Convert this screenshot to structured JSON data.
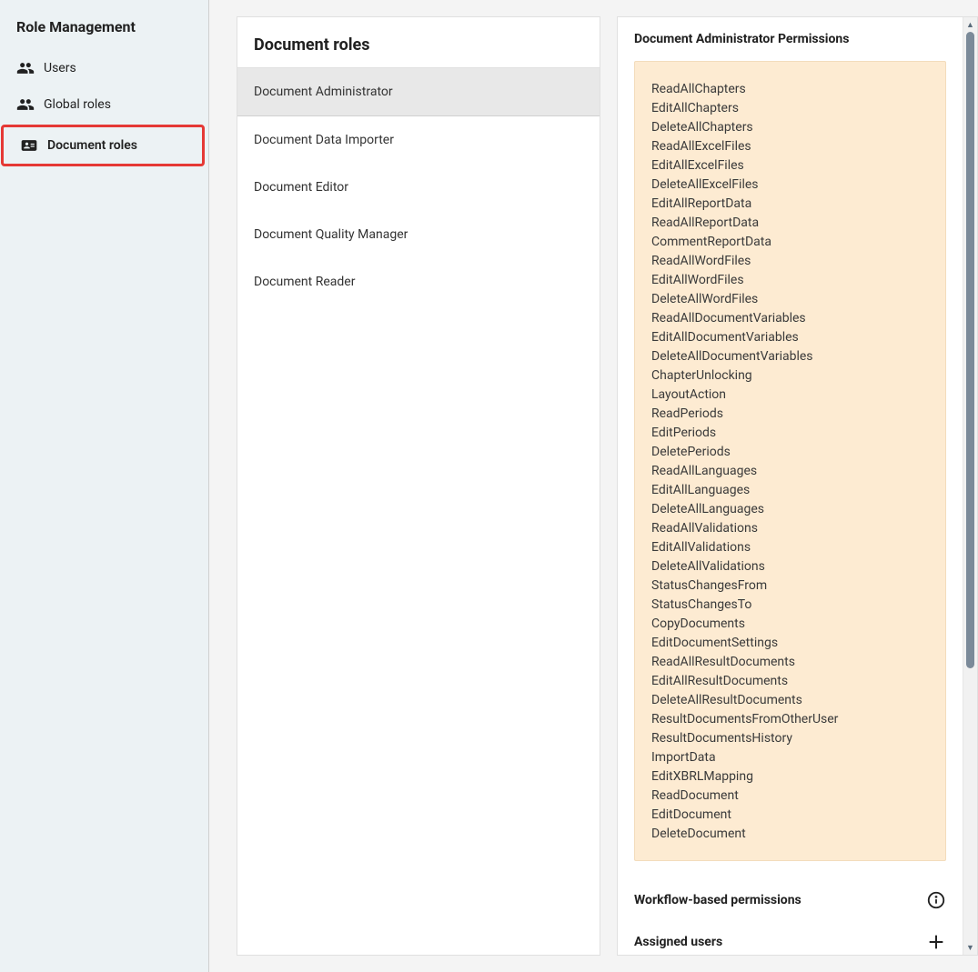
{
  "sidebar": {
    "title": "Role Management",
    "items": [
      {
        "label": "Users"
      },
      {
        "label": "Global roles"
      },
      {
        "label": "Document roles"
      }
    ]
  },
  "rolesPanel": {
    "header": "Document roles",
    "roles": [
      "Document Administrator",
      "Document Data Importer",
      "Document Editor",
      "Document Quality Manager",
      "Document Reader"
    ]
  },
  "details": {
    "title": "Document Administrator Permissions",
    "permissions": [
      "ReadAllChapters",
      "EditAllChapters",
      "DeleteAllChapters",
      "ReadAllExcelFiles",
      "EditAllExcelFiles",
      "DeleteAllExcelFiles",
      "EditAllReportData",
      "ReadAllReportData",
      "CommentReportData",
      "ReadAllWordFiles",
      "EditAllWordFiles",
      "DeleteAllWordFiles",
      "ReadAllDocumentVariables",
      "EditAllDocumentVariables",
      "DeleteAllDocumentVariables",
      "ChapterUnlocking",
      "LayoutAction",
      "ReadPeriods",
      "EditPeriods",
      "DeletePeriods",
      "ReadAllLanguages",
      "EditAllLanguages",
      "DeleteAllLanguages",
      "ReadAllValidations",
      "EditAllValidations",
      "DeleteAllValidations",
      "StatusChangesFrom",
      "StatusChangesTo",
      "CopyDocuments",
      "EditDocumentSettings",
      "ReadAllResultDocuments",
      "EditAllResultDocuments",
      "DeleteAllResultDocuments",
      "ResultDocumentsFromOtherUser",
      "ResultDocumentsHistory",
      "ImportData",
      "EditXBRLMapping",
      "ReadDocument",
      "EditDocument",
      "DeleteDocument"
    ],
    "workflowLabel": "Workflow-based permissions",
    "assignedUsersLabel": "Assigned users"
  }
}
